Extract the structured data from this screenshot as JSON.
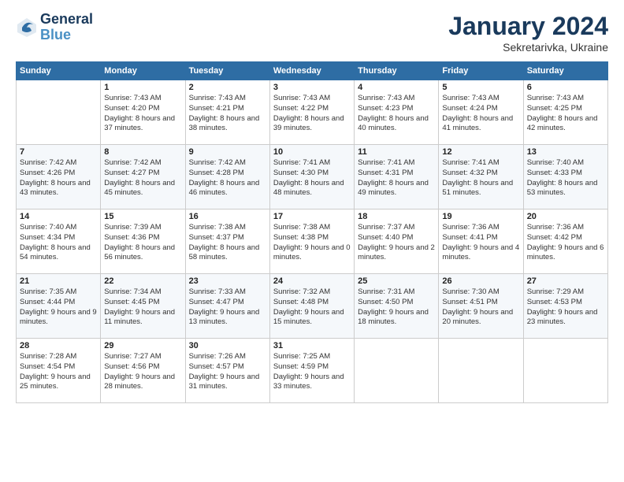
{
  "logo": {
    "line1": "General",
    "line2": "Blue"
  },
  "header": {
    "month": "January 2024",
    "location": "Sekretarivka, Ukraine"
  },
  "weekdays": [
    "Sunday",
    "Monday",
    "Tuesday",
    "Wednesday",
    "Thursday",
    "Friday",
    "Saturday"
  ],
  "weeks": [
    [
      {
        "day": "",
        "sunrise": "",
        "sunset": "",
        "daylight": ""
      },
      {
        "day": "1",
        "sunrise": "Sunrise: 7:43 AM",
        "sunset": "Sunset: 4:20 PM",
        "daylight": "Daylight: 8 hours and 37 minutes."
      },
      {
        "day": "2",
        "sunrise": "Sunrise: 7:43 AM",
        "sunset": "Sunset: 4:21 PM",
        "daylight": "Daylight: 8 hours and 38 minutes."
      },
      {
        "day": "3",
        "sunrise": "Sunrise: 7:43 AM",
        "sunset": "Sunset: 4:22 PM",
        "daylight": "Daylight: 8 hours and 39 minutes."
      },
      {
        "day": "4",
        "sunrise": "Sunrise: 7:43 AM",
        "sunset": "Sunset: 4:23 PM",
        "daylight": "Daylight: 8 hours and 40 minutes."
      },
      {
        "day": "5",
        "sunrise": "Sunrise: 7:43 AM",
        "sunset": "Sunset: 4:24 PM",
        "daylight": "Daylight: 8 hours and 41 minutes."
      },
      {
        "day": "6",
        "sunrise": "Sunrise: 7:43 AM",
        "sunset": "Sunset: 4:25 PM",
        "daylight": "Daylight: 8 hours and 42 minutes."
      }
    ],
    [
      {
        "day": "7",
        "sunrise": "Sunrise: 7:42 AM",
        "sunset": "Sunset: 4:26 PM",
        "daylight": "Daylight: 8 hours and 43 minutes."
      },
      {
        "day": "8",
        "sunrise": "Sunrise: 7:42 AM",
        "sunset": "Sunset: 4:27 PM",
        "daylight": "Daylight: 8 hours and 45 minutes."
      },
      {
        "day": "9",
        "sunrise": "Sunrise: 7:42 AM",
        "sunset": "Sunset: 4:28 PM",
        "daylight": "Daylight: 8 hours and 46 minutes."
      },
      {
        "day": "10",
        "sunrise": "Sunrise: 7:41 AM",
        "sunset": "Sunset: 4:30 PM",
        "daylight": "Daylight: 8 hours and 48 minutes."
      },
      {
        "day": "11",
        "sunrise": "Sunrise: 7:41 AM",
        "sunset": "Sunset: 4:31 PM",
        "daylight": "Daylight: 8 hours and 49 minutes."
      },
      {
        "day": "12",
        "sunrise": "Sunrise: 7:41 AM",
        "sunset": "Sunset: 4:32 PM",
        "daylight": "Daylight: 8 hours and 51 minutes."
      },
      {
        "day": "13",
        "sunrise": "Sunrise: 7:40 AM",
        "sunset": "Sunset: 4:33 PM",
        "daylight": "Daylight: 8 hours and 53 minutes."
      }
    ],
    [
      {
        "day": "14",
        "sunrise": "Sunrise: 7:40 AM",
        "sunset": "Sunset: 4:34 PM",
        "daylight": "Daylight: 8 hours and 54 minutes."
      },
      {
        "day": "15",
        "sunrise": "Sunrise: 7:39 AM",
        "sunset": "Sunset: 4:36 PM",
        "daylight": "Daylight: 8 hours and 56 minutes."
      },
      {
        "day": "16",
        "sunrise": "Sunrise: 7:38 AM",
        "sunset": "Sunset: 4:37 PM",
        "daylight": "Daylight: 8 hours and 58 minutes."
      },
      {
        "day": "17",
        "sunrise": "Sunrise: 7:38 AM",
        "sunset": "Sunset: 4:38 PM",
        "daylight": "Daylight: 9 hours and 0 minutes."
      },
      {
        "day": "18",
        "sunrise": "Sunrise: 7:37 AM",
        "sunset": "Sunset: 4:40 PM",
        "daylight": "Daylight: 9 hours and 2 minutes."
      },
      {
        "day": "19",
        "sunrise": "Sunrise: 7:36 AM",
        "sunset": "Sunset: 4:41 PM",
        "daylight": "Daylight: 9 hours and 4 minutes."
      },
      {
        "day": "20",
        "sunrise": "Sunrise: 7:36 AM",
        "sunset": "Sunset: 4:42 PM",
        "daylight": "Daylight: 9 hours and 6 minutes."
      }
    ],
    [
      {
        "day": "21",
        "sunrise": "Sunrise: 7:35 AM",
        "sunset": "Sunset: 4:44 PM",
        "daylight": "Daylight: 9 hours and 9 minutes."
      },
      {
        "day": "22",
        "sunrise": "Sunrise: 7:34 AM",
        "sunset": "Sunset: 4:45 PM",
        "daylight": "Daylight: 9 hours and 11 minutes."
      },
      {
        "day": "23",
        "sunrise": "Sunrise: 7:33 AM",
        "sunset": "Sunset: 4:47 PM",
        "daylight": "Daylight: 9 hours and 13 minutes."
      },
      {
        "day": "24",
        "sunrise": "Sunrise: 7:32 AM",
        "sunset": "Sunset: 4:48 PM",
        "daylight": "Daylight: 9 hours and 15 minutes."
      },
      {
        "day": "25",
        "sunrise": "Sunrise: 7:31 AM",
        "sunset": "Sunset: 4:50 PM",
        "daylight": "Daylight: 9 hours and 18 minutes."
      },
      {
        "day": "26",
        "sunrise": "Sunrise: 7:30 AM",
        "sunset": "Sunset: 4:51 PM",
        "daylight": "Daylight: 9 hours and 20 minutes."
      },
      {
        "day": "27",
        "sunrise": "Sunrise: 7:29 AM",
        "sunset": "Sunset: 4:53 PM",
        "daylight": "Daylight: 9 hours and 23 minutes."
      }
    ],
    [
      {
        "day": "28",
        "sunrise": "Sunrise: 7:28 AM",
        "sunset": "Sunset: 4:54 PM",
        "daylight": "Daylight: 9 hours and 25 minutes."
      },
      {
        "day": "29",
        "sunrise": "Sunrise: 7:27 AM",
        "sunset": "Sunset: 4:56 PM",
        "daylight": "Daylight: 9 hours and 28 minutes."
      },
      {
        "day": "30",
        "sunrise": "Sunrise: 7:26 AM",
        "sunset": "Sunset: 4:57 PM",
        "daylight": "Daylight: 9 hours and 31 minutes."
      },
      {
        "day": "31",
        "sunrise": "Sunrise: 7:25 AM",
        "sunset": "Sunset: 4:59 PM",
        "daylight": "Daylight: 9 hours and 33 minutes."
      },
      {
        "day": "",
        "sunrise": "",
        "sunset": "",
        "daylight": ""
      },
      {
        "day": "",
        "sunrise": "",
        "sunset": "",
        "daylight": ""
      },
      {
        "day": "",
        "sunrise": "",
        "sunset": "",
        "daylight": ""
      }
    ]
  ]
}
